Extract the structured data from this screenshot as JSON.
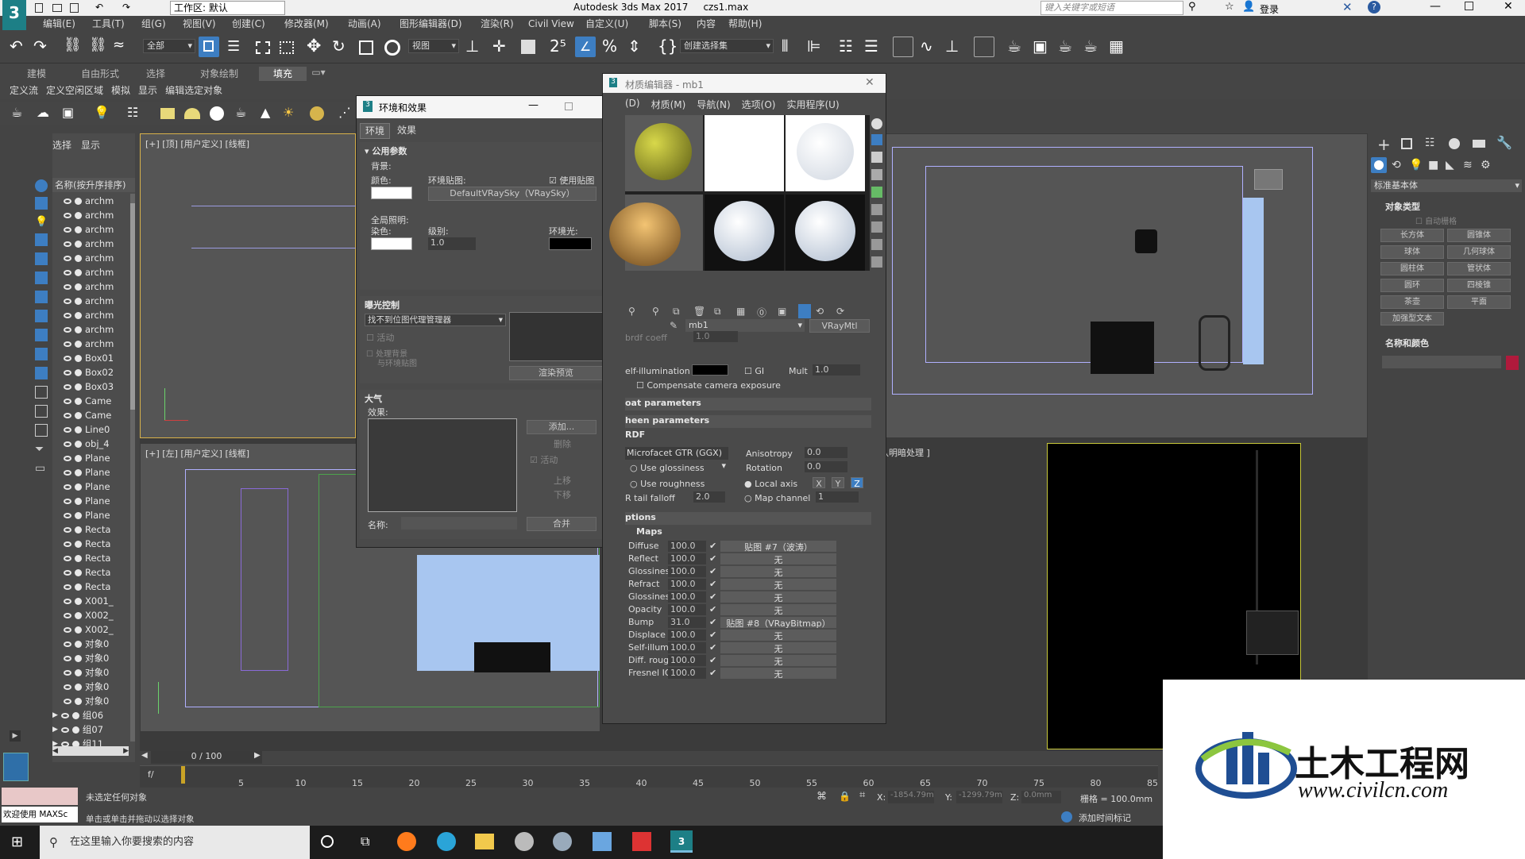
{
  "title": {
    "app": "Autodesk 3ds Max 2017",
    "file": "czs1.max",
    "workspace": "工作区: 默认",
    "search_placeholder": "键入关键字或短语",
    "login": "登录"
  },
  "menu": [
    "编辑(E)",
    "工具(T)",
    "组(G)",
    "视图(V)",
    "创建(C)",
    "修改器(M)",
    "动画(A)",
    "图形编辑器(D)",
    "渲染(R)",
    "Civil View",
    "自定义(U)",
    "脚本(S)",
    "内容",
    "帮助(H)"
  ],
  "toolbar": {
    "filter": "全部",
    "ref_coord": "视图",
    "selection_set": "创建选择集"
  },
  "ribbon_tabs": [
    "建模",
    "自由形式",
    "选择",
    "对象绘制",
    "填充"
  ],
  "ribbon_sub": [
    "定义流",
    "定义空闲区域",
    "模拟",
    "显示",
    "编辑选定对象"
  ],
  "scene_explorer": {
    "tabs": [
      "选择",
      "显示"
    ],
    "header": "名称(按升序排序)",
    "items": [
      "archm",
      "archm",
      "archm",
      "archm",
      "archm",
      "archm",
      "archm",
      "archm",
      "archm",
      "archm",
      "archm",
      "Box01",
      "Box02",
      "Box03",
      "Came",
      "Came",
      "Line0",
      "obj_4",
      "Plane",
      "Plane",
      "Plane",
      "Plane",
      "Plane",
      "Recta",
      "Recta",
      "Recta",
      "Recta",
      "Recta",
      "X001_",
      "X002_",
      "X002_",
      "对象0",
      "对象0",
      "对象0",
      "对象0",
      "对象0",
      "组06",
      "组07",
      "组11"
    ]
  },
  "viewports": {
    "top_left": "[+] [顶] [用户定义] [线框]",
    "bottom_left": "[+] [左] [用户定义] [线框]",
    "bottom_right": "认明暗处理 ]"
  },
  "env_dialog": {
    "title": "环境和效果",
    "tabs": [
      "环境",
      "效果"
    ],
    "common": "公用参数",
    "bg": "背景:",
    "color": "颜色:",
    "env_map": "环境贴图:",
    "use_map": "使用贴图",
    "map_name": "DefaultVRaySky（VRaySky）",
    "global_light": "全局照明:",
    "tint": "染色:",
    "level": "级别:",
    "level_val": "1.0",
    "ambient": "环境光:",
    "exposure": "曝光控制",
    "exposure_sel": "找不到位图代理管理器",
    "active": "活动",
    "process_bg": "处理背景",
    "process_bg2": "与环境贴图",
    "render_preview": "渲染预览",
    "atmosphere": "大气",
    "effects": "效果:",
    "add": "添加...",
    "delete": "删除",
    "active2": "活动",
    "up": "上移",
    "down": "下移",
    "name": "名称:",
    "merge": "合并"
  },
  "mat_editor": {
    "title": "材质编辑器 - mb1",
    "menu": [
      "(D)",
      "材质(M)",
      "导航(N)",
      "选项(O)",
      "实用程序(U)"
    ],
    "mat_name": "mb1",
    "mat_type": "VRayMtl",
    "rows": {
      "brdf_coeff": "brdf coeff",
      "brdf_val": "1.0",
      "self_illum": "elf-illumination",
      "gi": "GI",
      "mult": "Mult",
      "mult_val": "1.0",
      "comp": "Compensate camera exposure",
      "coat": "oat parameters",
      "sheen": "heen parameters",
      "brdf": "RDF",
      "brdf_type": "Microfacet GTR (GGX)",
      "aniso": "Anisotropy",
      "aniso_val": "0.0",
      "rotation": "Rotation",
      "rot_val": "0.0",
      "use_gloss": "Use glossiness",
      "use_rough": "Use roughness",
      "local_axis": "Local axis",
      "x": "X",
      "y": "Y",
      "z": "Z",
      "tail": "R tail falloff",
      "tail_val": "2.0",
      "map_ch": "Map channel",
      "map_ch_val": "1",
      "options": "ptions",
      "maps": "Maps"
    },
    "maps": [
      {
        "name": "Diffuse",
        "val": "100.0",
        "slot": "贴图 #7（波涛）"
      },
      {
        "name": "Reflect",
        "val": "100.0",
        "slot": "无"
      },
      {
        "name": "Glossiness",
        "val": "100.0",
        "slot": "无"
      },
      {
        "name": "Refract",
        "val": "100.0",
        "slot": "无"
      },
      {
        "name": "Glossiness",
        "val": "100.0",
        "slot": "无"
      },
      {
        "name": "Opacity",
        "val": "100.0",
        "slot": "无"
      },
      {
        "name": "Bump",
        "val": "31.0",
        "slot": "贴图 #8（VRayBitmap）"
      },
      {
        "name": "Displace",
        "val": "100.0",
        "slot": "无"
      },
      {
        "name": "Self-illum",
        "val": "100.0",
        "slot": "无"
      },
      {
        "name": "Diff. rough.",
        "val": "100.0",
        "slot": "无"
      },
      {
        "name": "Fresnel IOR",
        "val": "100.0",
        "slot": "无"
      }
    ]
  },
  "command_panel": {
    "dropdown": "标准基本体",
    "obj_type": "对象类型",
    "autogrid": "自动栅格",
    "buttons": [
      "长方体",
      "圆锥体",
      "球体",
      "几何球体",
      "圆柱体",
      "管状体",
      "圆环",
      "四棱锥",
      "茶壶",
      "平面",
      "加强型文本"
    ],
    "name_color": "名称和颜色"
  },
  "timeline": {
    "frame": "0 / 100",
    "ticks": [
      "5",
      "10",
      "15",
      "20",
      "25",
      "30",
      "35",
      "40",
      "45",
      "50",
      "55",
      "60",
      "65",
      "70",
      "75",
      "80",
      "85"
    ]
  },
  "status": {
    "welcome": "欢迎使用 MAXSc",
    "no_sel": "未选定任何对象",
    "hint": "单击或单击并拖动以选择对象",
    "x": "X:",
    "x_val": "-1854.79m",
    "y": "Y:",
    "y_val": "-1299.79m",
    "z": "Z:",
    "z_val": "0.0mm",
    "grid": "栅格 = 100.0mm",
    "add_tag": "添加时间标记"
  },
  "taskbar": {
    "search": "在这里输入你要搜索的内容"
  },
  "watermark": {
    "brand": "土木工程网",
    "url": "www.civilcn.com"
  },
  "colors": {
    "accent": "#3d7ec2",
    "vp_bg": "#555555",
    "dark_vp": "#000000",
    "wm_blue": "#1f4e93",
    "wm_green": "#8cc63f"
  }
}
